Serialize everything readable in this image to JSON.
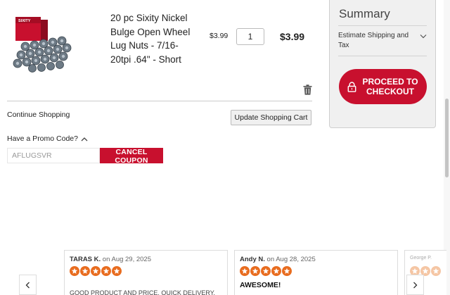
{
  "cart": {
    "item": {
      "name": "20 pc Sixity Nickel Bulge Open Wheel Lug Nuts - 7/16-20tpi .64\" - Short",
      "unit_price": "$3.99",
      "quantity": "1",
      "row_total": "$3.99",
      "image_icon": "lug-nuts-product-photo",
      "box_brand": "SIXITY"
    },
    "remove_icon": "trash-icon",
    "continue_label": "Continue Shopping",
    "update_label": "Update Shopping Cart",
    "promo": {
      "toggle_label": "Have a Promo Code?",
      "toggle_icon": "chevron-up-icon",
      "code_value": "AFLUGSVR",
      "cancel_label": "CANCEL COUPON"
    }
  },
  "summary": {
    "title": "Summary",
    "estimate_label": "Estimate Shipping and Tax",
    "estimate_icon": "chevron-down-icon",
    "checkout_label": "PROCEED TO\nCHECKOUT",
    "checkout_icon": "lock-icon"
  },
  "reviews": {
    "prev_icon": "chevron-left-icon",
    "next_icon": "chevron-right-icon",
    "items": [
      {
        "author": "TARAS K.",
        "date": "on Aug 29, 2025",
        "rating": 5,
        "heading": "",
        "body": "GOOD PRODUCT AND PRICE. QUICK DELIVERY."
      },
      {
        "author": "Andy N.",
        "date": "on Aug 28, 2025",
        "rating": 5,
        "heading": "AWESOME!",
        "body": ""
      },
      {
        "author": "George P.",
        "date": "",
        "rating": 5,
        "heading": "",
        "body": ""
      }
    ]
  },
  "colors": {
    "brand_red": "#c8102e",
    "star_orange": "#e86c1f",
    "summary_bg": "#f0f0f0"
  }
}
